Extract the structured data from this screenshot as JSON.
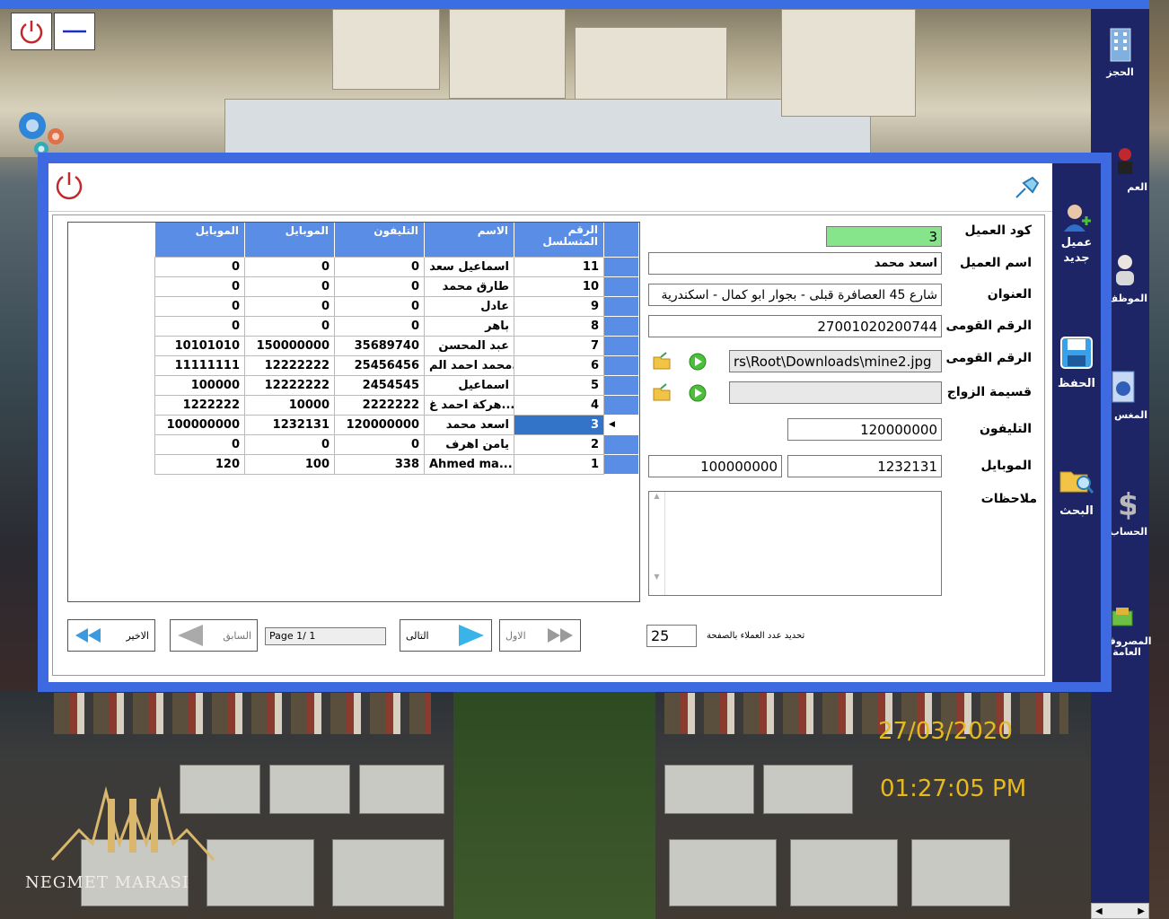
{
  "window_controls": {
    "power_icon": "power-icon",
    "minimize_icon": "minimize-icon"
  },
  "sidebar": {
    "items": [
      {
        "label": "الحجز",
        "icon": "building-icon"
      },
      {
        "label": "العم",
        "icon": "clients-icon"
      },
      {
        "label": "الموظف",
        "icon": "employee-icon"
      },
      {
        "label": "المغس",
        "icon": "washing-icon"
      },
      {
        "label": "الحساب",
        "icon": "dollar-icon"
      },
      {
        "label": "المصروف العامة",
        "icon": "money-icon"
      }
    ]
  },
  "dialog": {
    "actions": [
      {
        "label": "عميل جديد",
        "icon": "add-user-icon"
      },
      {
        "label": "الحفظ",
        "icon": "save-icon"
      },
      {
        "label": "البحث",
        "icon": "search-folder-icon"
      }
    ],
    "form": {
      "client_code_label": "كود العميل",
      "client_code": "3",
      "client_name_label": "اسم العميل",
      "client_name": "اسعد محمد",
      "address_label": "العنوان",
      "address": "شارع 45 العصافرة قبلى - بجوار ابو كمال - اسكندرية",
      "national_id_label": "الرقم القومى",
      "national_id": "27001020200744",
      "national_id_image_label": "الرقم القومى",
      "national_id_image": "rs\\Root\\Downloads\\mine2.jpg",
      "marriage_doc_label": "قسيمة الزواج",
      "marriage_doc": "",
      "phone_label": "التليفون",
      "phone": "120000000",
      "mobile_label": "الموبايل",
      "mobile1": "1232131",
      "mobile2": "100000000",
      "notes_label": "ملاحظات",
      "notes": ""
    },
    "grid": {
      "headers": [
        "الرقم المتسلسل",
        "الاسم",
        "التليفون",
        "الموبايل",
        "الموبايل"
      ],
      "rows": [
        [
          "11",
          "اسماعيل سعد",
          "0",
          "0",
          "0"
        ],
        [
          "10",
          "طارق محمد",
          "0",
          "0",
          "0"
        ],
        [
          "9",
          "عادل",
          "0",
          "0",
          "0"
        ],
        [
          "8",
          "باهر",
          "0",
          "0",
          "0"
        ],
        [
          "7",
          "عبد المحسن",
          "35689740",
          "150000000",
          "10101010"
        ],
        [
          "6",
          "محمد احمد الم...",
          "25456456",
          "12222222",
          "11111111"
        ],
        [
          "5",
          "اسماعيل",
          "2454545",
          "12222222",
          "100000"
        ],
        [
          "4",
          "هركة احمد غ...",
          "2222222",
          "10000",
          "1222222"
        ],
        [
          "3",
          "اسعد محمد",
          "120000000",
          "1232131",
          "100000000"
        ],
        [
          "2",
          "يامن اهرف",
          "0",
          "0",
          "0"
        ],
        [
          "1",
          "Ahmed ma...",
          "338",
          "100",
          "120"
        ]
      ],
      "selected_index": 8
    },
    "pager": {
      "last": "الاخير",
      "prev": "السابق",
      "page": "Page 1/ 1",
      "next": "التالى",
      "first": "الاول",
      "per_page_label": "تحديد عدد العملاء بالصفحة",
      "per_page": "25"
    }
  },
  "clock": {
    "date": "27/03/2020",
    "time": "01:27:05 PM"
  },
  "brand": {
    "name": "NEGMET MARASI"
  }
}
